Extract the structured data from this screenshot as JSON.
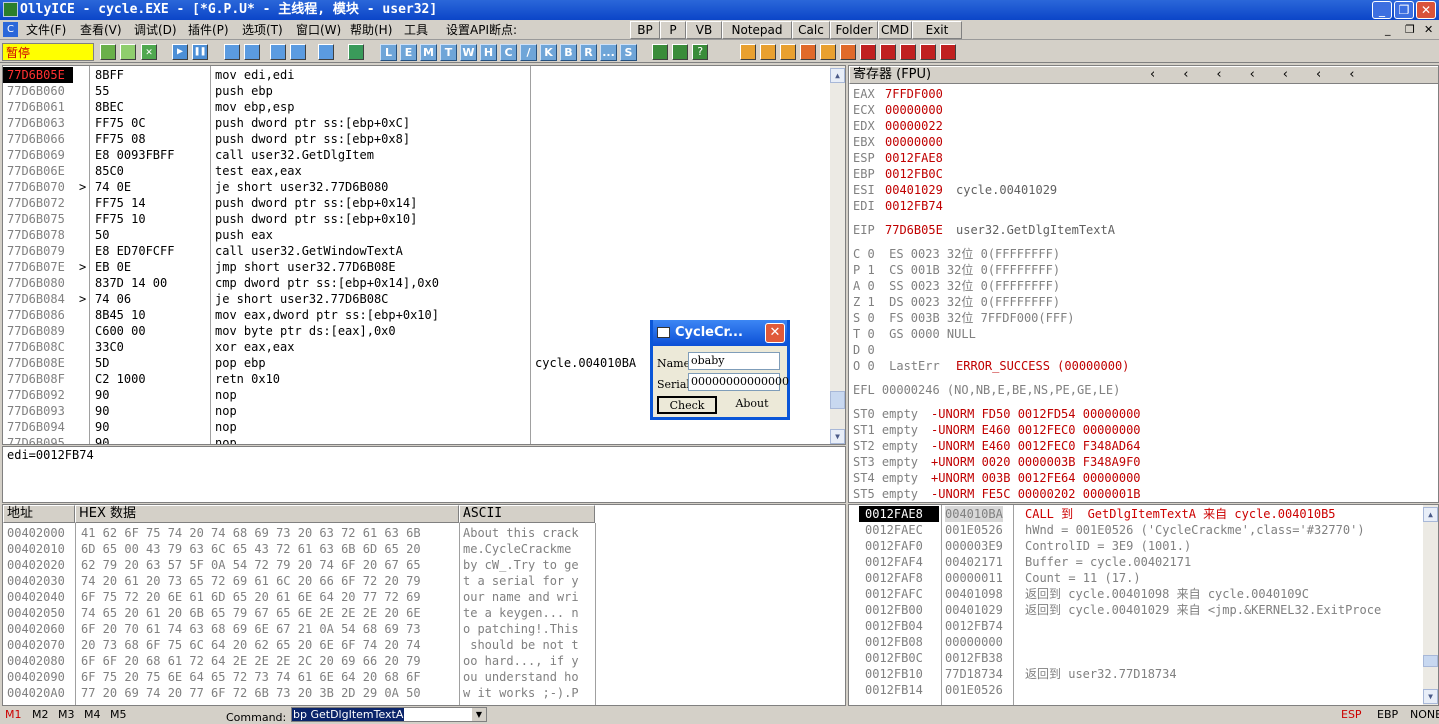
{
  "title": "OllyICE - cycle.EXE - [*G.P.U* -  主线程, 模块 - user32]",
  "menu": [
    "文件(F)",
    "查看(V)",
    "调试(D)",
    "插件(P)",
    "选项(T)",
    "窗口(W)",
    "帮助(H)",
    "工具",
    "设置API断点:"
  ],
  "toolbtns": [
    "BP",
    "P",
    "VB",
    "Notepad",
    "Calc",
    "Folder",
    "CMD",
    "Exit"
  ],
  "status": "暂停",
  "letters": [
    "L",
    "E",
    "M",
    "T",
    "W",
    "H",
    "C",
    "/",
    "K",
    "B",
    "R",
    "...",
    "S"
  ],
  "disasm": [
    {
      "a": "77D6B05E",
      "h": "8BFF",
      "i": "mov edi,edi",
      "sel": true
    },
    {
      "a": "77D6B060",
      "h": "55",
      "i": "push ebp"
    },
    {
      "a": "77D6B061",
      "h": "8BEC",
      "i": "mov ebp,esp"
    },
    {
      "a": "77D6B063",
      "h": "FF75 0C",
      "i": "push dword ptr ss:[ebp+0xC]"
    },
    {
      "a": "77D6B066",
      "h": "FF75 08",
      "i": "push dword ptr ss:[ebp+0x8]"
    },
    {
      "a": "77D6B069",
      "h": "E8 0093FBFF",
      "i": "call user32.GetDlgItem"
    },
    {
      "a": "77D6B06E",
      "h": "85C0",
      "i": "test eax,eax"
    },
    {
      "a": "77D6B070",
      "h": "74 0E",
      "i": "je short user32.77D6B080",
      "j": true
    },
    {
      "a": "77D6B072",
      "h": "FF75 14",
      "i": "push dword ptr ss:[ebp+0x14]"
    },
    {
      "a": "77D6B075",
      "h": "FF75 10",
      "i": "push dword ptr ss:[ebp+0x10]"
    },
    {
      "a": "77D6B078",
      "h": "50",
      "i": "push eax"
    },
    {
      "a": "77D6B079",
      "h": "E8 ED70FCFF",
      "i": "call user32.GetWindowTextA"
    },
    {
      "a": "77D6B07E",
      "h": "EB 0E",
      "i": "jmp short user32.77D6B08E",
      "j": true
    },
    {
      "a": "77D6B080",
      "h": "837D 14 00",
      "i": "cmp dword ptr ss:[ebp+0x14],0x0"
    },
    {
      "a": "77D6B084",
      "h": "74 06",
      "i": "je short user32.77D6B08C",
      "j": true
    },
    {
      "a": "77D6B086",
      "h": "8B45 10",
      "i": "mov eax,dword ptr ss:[ebp+0x10]"
    },
    {
      "a": "77D6B089",
      "h": "C600 00",
      "i": "mov byte ptr ds:[eax],0x0"
    },
    {
      "a": "77D6B08C",
      "h": "33C0",
      "i": "xor eax,eax"
    },
    {
      "a": "77D6B08E",
      "h": "5D",
      "i": "pop ebp",
      "c": "cycle.004010BA"
    },
    {
      "a": "77D6B08F",
      "h": "C2 1000",
      "i": "retn 0x10"
    },
    {
      "a": "77D6B092",
      "h": "90",
      "i": "nop"
    },
    {
      "a": "77D6B093",
      "h": "90",
      "i": "nop"
    },
    {
      "a": "77D6B094",
      "h": "90",
      "i": "nop"
    },
    {
      "a": "77D6B095",
      "h": "90",
      "i": "nop"
    }
  ],
  "info": "edi=0012FB74",
  "reg_header": "寄存器 (FPU)",
  "regs": [
    {
      "n": "EAX",
      "v": "7FFDF000",
      "c": ""
    },
    {
      "n": "ECX",
      "v": "00000000",
      "c": ""
    },
    {
      "n": "EDX",
      "v": "00000022",
      "c": ""
    },
    {
      "n": "EBX",
      "v": "00000000",
      "c": ""
    },
    {
      "n": "ESP",
      "v": "0012FAE8",
      "c": ""
    },
    {
      "n": "EBP",
      "v": "0012FB0C",
      "c": ""
    },
    {
      "n": "ESI",
      "v": "00401029",
      "c": "cycle.00401029"
    },
    {
      "n": "EDI",
      "v": "0012FB74",
      "c": ""
    }
  ],
  "eip": {
    "n": "EIP",
    "v": "77D6B05E",
    "c": "user32.GetDlgItemTextA"
  },
  "flags": [
    "C 0  ES 0023 32位 0(FFFFFFFF)",
    "P 1  CS 001B 32位 0(FFFFFFFF)",
    "A 0  SS 0023 32位 0(FFFFFFFF)",
    "Z 1  DS 0023 32位 0(FFFFFFFF)",
    "S 0  FS 003B 32位 7FFDF000(FFF)",
    "T 0  GS 0000 NULL",
    "D 0"
  ],
  "lasterr_pre": "O 0  LastErr ",
  "lasterr_val": "ERROR_SUCCESS (00000000)",
  "efl": "EFL 00000246 (NO,NB,E,BE,NS,PE,GE,LE)",
  "fpu": [
    {
      "n": "ST0 empty",
      "v": "-UNORM FD50 0012FD54 00000000"
    },
    {
      "n": "ST1 empty",
      "v": "-UNORM E460 0012FEC0 00000000"
    },
    {
      "n": "ST2 empty",
      "v": "-UNORM E460 0012FEC0 F348AD64"
    },
    {
      "n": "ST3 empty",
      "v": "+UNORM 0020 0000003B F348A9F0"
    },
    {
      "n": "ST4 empty",
      "v": "+UNORM 003B 0012FE64 00000000"
    },
    {
      "n": "ST5 empty",
      "v": "-UNORM FE5C 00000202 0000001B"
    }
  ],
  "dump_header": {
    "addr": "地址",
    "hex": "HEX 数据",
    "ascii": "ASCII"
  },
  "dump": [
    {
      "a": "00402000",
      "h": "41 62 6F 75 74 20 74 68 69 73 20 63 72 61 63 6B",
      "s": "About this crack"
    },
    {
      "a": "00402010",
      "h": "6D 65 00 43 79 63 6C 65 43 72 61 63 6B 6D 65 20",
      "s": "me.CycleCrackme "
    },
    {
      "a": "00402020",
      "h": "62 79 20 63 57 5F 0A 54 72 79 20 74 6F 20 67 65",
      "s": "by cW_.Try to ge"
    },
    {
      "a": "00402030",
      "h": "74 20 61 20 73 65 72 69 61 6C 20 66 6F 72 20 79",
      "s": "t a serial for y"
    },
    {
      "a": "00402040",
      "h": "6F 75 72 20 6E 61 6D 65 20 61 6E 64 20 77 72 69",
      "s": "our name and wri"
    },
    {
      "a": "00402050",
      "h": "74 65 20 61 20 6B 65 79 67 65 6E 2E 2E 2E 20 6E",
      "s": "te a keygen... n"
    },
    {
      "a": "00402060",
      "h": "6F 20 70 61 74 63 68 69 6E 67 21 0A 54 68 69 73",
      "s": "o patching!.This"
    },
    {
      "a": "00402070",
      "h": "20 73 68 6F 75 6C 64 20 62 65 20 6E 6F 74 20 74",
      "s": " should be not t"
    },
    {
      "a": "00402080",
      "h": "6F 6F 20 68 61 72 64 2E 2E 2E 2C 20 69 66 20 79",
      "s": "oo hard..., if y"
    },
    {
      "a": "00402090",
      "h": "6F 75 20 75 6E 64 65 72 73 74 61 6E 64 20 68 6F",
      "s": "ou understand ho"
    },
    {
      "a": "004020A0",
      "h": "77 20 69 74 20 77 6F 72 6B 73 20 3B 2D 29 0A 50",
      "s": "w it works ;-).P"
    }
  ],
  "stack": [
    {
      "a": "0012FAE8",
      "v": "004010BA",
      "c": "CALL 到  GetDlgItemTextA 来自 cycle.004010B5",
      "sel": true
    },
    {
      "a": "0012FAEC",
      "v": "001E0526",
      "c": "hWnd = 001E0526 ('CycleCrackme',class='#32770')"
    },
    {
      "a": "0012FAF0",
      "v": "000003E9",
      "c": "ControlID = 3E9 (1001.)"
    },
    {
      "a": "0012FAF4",
      "v": "00402171",
      "c": "Buffer = cycle.00402171"
    },
    {
      "a": "0012FAF8",
      "v": "00000011",
      "c": "Count = 11 (17.)"
    },
    {
      "a": "0012FAFC",
      "v": "00401098",
      "c": "返回到 cycle.00401098 来自 cycle.0040109C"
    },
    {
      "a": "0012FB00",
      "v": "00401029",
      "c": "返回到 cycle.00401029 来自 <jmp.&KERNEL32.ExitProce"
    },
    {
      "a": "0012FB04",
      "v": "0012FB74",
      "c": ""
    },
    {
      "a": "0012FB08",
      "v": "00000000",
      "c": ""
    },
    {
      "a": "0012FB0C",
      "v": "0012FB38",
      "c": ""
    },
    {
      "a": "0012FB10",
      "v": "77D18734",
      "c": "返回到 user32.77D18734"
    },
    {
      "a": "0012FB14",
      "v": "001E0526",
      "c": ""
    }
  ],
  "dialog": {
    "title": "CycleCr...",
    "name_label": "Name",
    "name_value": "obaby",
    "serial_label": "Serial",
    "serial_value": "00000000000000",
    "check": "Check",
    "about": "About"
  },
  "bottom": {
    "m": [
      "M1",
      "M2",
      "M3",
      "M4",
      "M5"
    ],
    "command_label": "Command:",
    "command_value": "bp GetDlgItemTextA",
    "esp": "ESP",
    "ebp": "EBP",
    "none": "NONE"
  }
}
